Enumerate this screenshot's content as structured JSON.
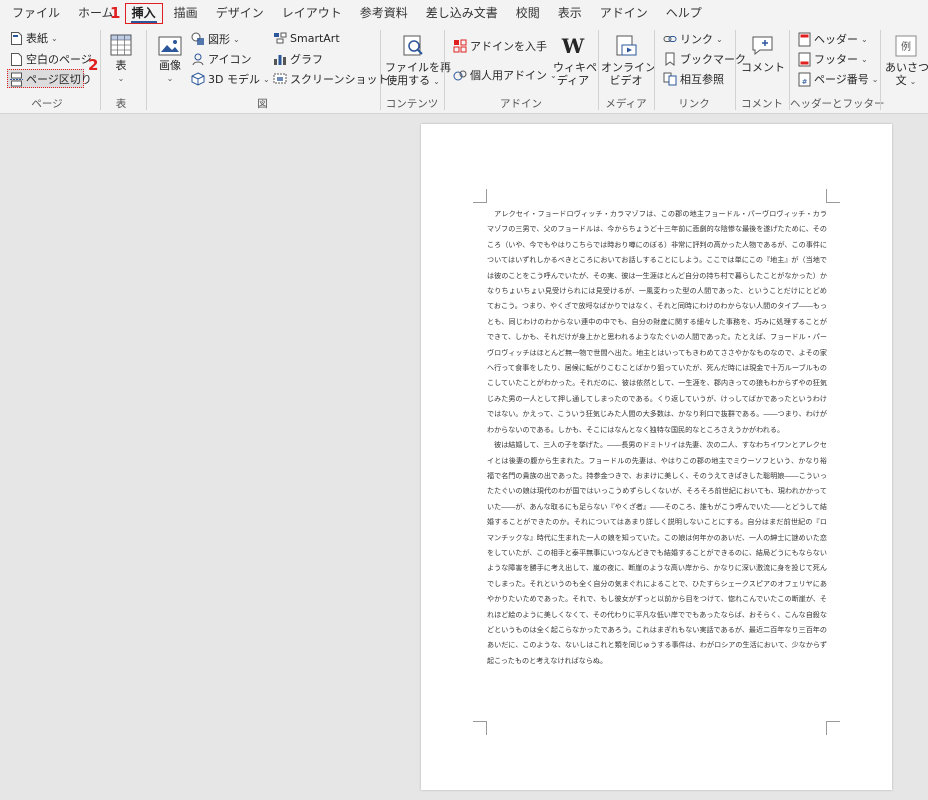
{
  "tabs": [
    "ファイル",
    "ホーム",
    "挿入",
    "描画",
    "デザイン",
    "レイアウト",
    "参考資料",
    "差し込み文書",
    "校閲",
    "表示",
    "アドイン",
    "ヘルプ"
  ],
  "steps": {
    "step1": "1",
    "step2": "2"
  },
  "ribbon": {
    "page_group": {
      "label": "ページ",
      "cover": "表紙",
      "blank": "空白のページ",
      "break": "ページ区切り"
    },
    "table_group": {
      "label": "表",
      "table": "表"
    },
    "illust_group": {
      "label": "図",
      "picture": "画像",
      "shapes": "図形",
      "icons": "アイコン",
      "model3d": "3D モデル",
      "smartart": "SmartArt",
      "chart": "グラフ",
      "screenshot": "スクリーンショット"
    },
    "content_group": {
      "label": "コンテンツ",
      "reuse_line1": "ファイルを再",
      "reuse_line2": "使用する"
    },
    "addin_group": {
      "label": "アドイン",
      "get": "アドインを入手",
      "my": "個人用アドイン",
      "wiki_line1": "ウィキペ",
      "wiki_line2": "ディア"
    },
    "media_group": {
      "label": "メディア",
      "video_line1": "オンライン",
      "video_line2": "ビデオ"
    },
    "link_group": {
      "label": "リンク",
      "link": "リンク",
      "bookmark": "ブックマーク",
      "crossref": "相互参照"
    },
    "comment_group": {
      "label": "コメント",
      "comment": "コメント"
    },
    "hf_group": {
      "label": "ヘッダーとフッター",
      "header": "ヘッダー",
      "footer": "フッター",
      "pagenum": "ページ番号"
    },
    "text_group": {
      "greeting_line1": "あいさつ",
      "greeting_line2": "文"
    }
  },
  "document": {
    "paragraphs": [
      "アレクセイ・フョードロヴィッチ・カラマゾフは、この郡の地主フョードル・パーヴロヴィッチ・カラマゾフの三男で、父のフョードルは、今からちょうど十三年前に悲劇的な陰惨な最後を遂げたために、そのころ（いや、今でもやはりこちらでは時おり噂にのぼる）非常に評判の高かった人物であるが、この事件についてはいずれしかるべきところにおいてお話しすることにしよう。ここでは単にこの『地主』が（当地では彼のことをこう呼んでいたが、その実、彼は一生涯ほとんど自分の持ち村で暮らしたことがなかった）かなりちょいちょい見受けられには見受けるが、一風変わった型の人間であった、ということだけにとどめておこう。つまり、やくざで放埒なばかりではなく、それと同時にわけのわからない人間のタイプ――もっとも、同じわけのわからない連中の中でも、自分の財産に関する細々した事務を、巧みに処理することができて、しかも、それだけが身上かと思われるようなたぐいの人間であった。たとえば、フョードル・パーヴロヴィッチはほとんど無一物で世間へ出た。地主とはいってもきわめてささやかなものなので、よその家へ行って食事をしたり、居候に転がりこむことばかり狙っていたが、死んだ時には現金で十万ルーブルものこしていたことがわかった。それだのに、彼は依然として、一生涯を、郡内きっての狼もわからずやの狂気じみた男の一人として押し通してしまったのである。くり返していうが、けっしてばかであったというわけではない。かえって、こういう狂気じみた人間の大多数は、かなり利口で抜群である。――つまり、わけがわからないのである。しかも、そこにはなんとなく独特な国民的なところさえうかがわれる。",
      "彼は結婚して、三人の子を挙げた。――長男のドミトリイは先妻、次の二人、すなわちイワンとアレクセイとは後妻の腹から生まれた。フョードルの先妻は、やはりこの郡の地主でミウーソフという、かなり裕福で名門の貴族の出であった。持参金つきで、おまけに美しく、そのうえてきぱきした聡明娘――こういったたぐいの娘は現代のわが国ではいっこうめずらしくないが、そろそろ前世紀においても、現われかかっていた――が、あんな取るにも足らない『やくざ者』――そのころ、誰もがこう呼んでいた――とどうして結婚することができたのか。それについてはあまり詳しく説明しないことにする。自分はまだ前世紀の『ロマンチックな』時代に生まれた一人の娘を知っていた。この娘は何年かのあいだ、一人の紳士に謎めいた恋をしていたが、この相手と泰平無事にいつなんどきでも結婚することができるのに、結局どうにもならないような障害を勝手に考え出して、嵐の夜に、断崖のような高い岸から、かなりに深い激流に身を投じて死んでしまった。それというのも全く自分の気まぐれによることで、ひたすらシェークスピアのオフェリヤにあやかりたいためであった。それで、もし彼女がずっと以前から目をつけて、惚れこんでいたこの断崖が、それほど絵のように美しくなくて、その代わりに平凡な低い岸ででもあったならば、おそらく、こんな自殺などというものは全く起こらなかったであろう。これはまぎれもない実話であるが、最近二百年なり三百年のあいだに、このような、ないしはこれと類を同じゅうする事件は、わがロシアの生活において、少なからず起こったものと考えなければならぬ。"
    ]
  }
}
